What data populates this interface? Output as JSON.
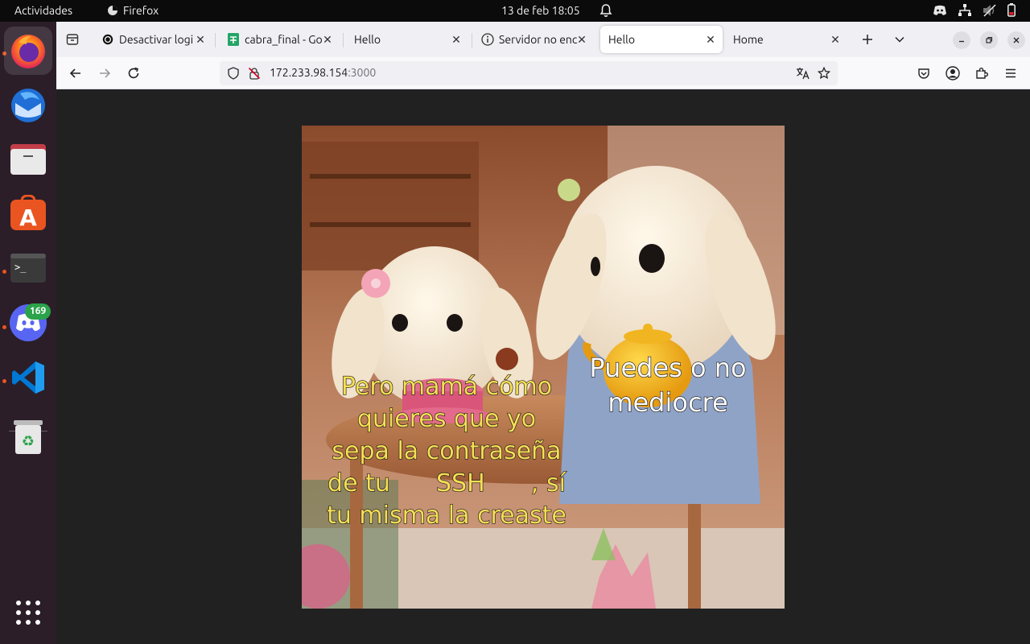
{
  "topbar": {
    "activities": "Actividades",
    "app_name": "Firefox",
    "clock": "13 de feb  18:05"
  },
  "dock": {
    "discord_badge": "169"
  },
  "tabs": [
    {
      "title": "Desactivar logi",
      "icon": "openai-icon"
    },
    {
      "title": "cabra_final - Go",
      "icon": "sheets-icon"
    },
    {
      "title": "Hello",
      "icon": ""
    },
    {
      "title": "Servidor no enc",
      "icon": "info-icon"
    },
    {
      "title": "Hello",
      "icon": ""
    },
    {
      "title": "Home",
      "icon": ""
    }
  ],
  "url": {
    "host": "172.233.98.154",
    "port": ":3000"
  },
  "meme": {
    "left_caption_line1": "Pero mamá cómo",
    "left_caption_line2": "quieres que yo",
    "left_caption_line3": "sepa la contraseña",
    "left_caption_line4": "de tu      SSH      , sí",
    "left_caption_line5": "tu misma la creaste",
    "right_caption_line1": "Puedes o no",
    "right_caption_line2": "mediocre"
  },
  "colors": {
    "caption_yellow": "#f7df55",
    "caption_white": "#ffffff",
    "ubuntu_orange": "#e95420"
  }
}
